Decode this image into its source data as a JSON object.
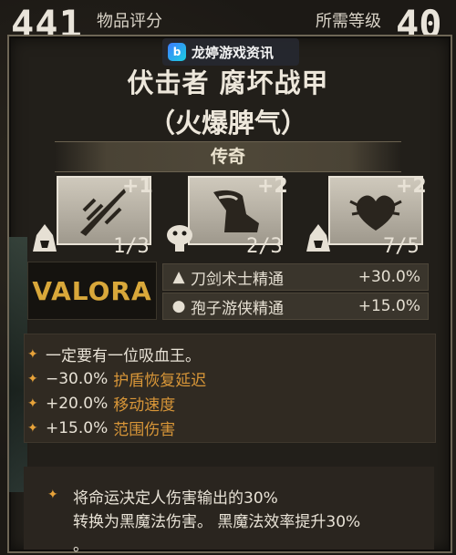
{
  "header": {
    "item_score": "441",
    "item_score_label": "物品评分",
    "required_level_label": "所需等级",
    "required_level": "40"
  },
  "watermark": {
    "logo": "b",
    "text": "龙婷游戏资讯"
  },
  "item": {
    "name_line1": "伏击者 腐坏战甲",
    "name_line2": "（火爆脾气）",
    "rarity": "传奇"
  },
  "talents": [
    {
      "icon": "sword-slash-icon",
      "bonus": "+1",
      "progress": "1/3",
      "class_icon": "hooded-rogue-icon"
    },
    {
      "icon": "boot-icon",
      "bonus": "+2",
      "progress": "2/3",
      "class_icon": "mushroom-icon"
    },
    {
      "icon": "heart-wings-icon",
      "bonus": "+2",
      "progress": "7/5",
      "class_icon": "hooded-rogue-icon"
    }
  ],
  "brand": {
    "name": "VALORA",
    "color": "#d9a83a"
  },
  "masteries": [
    {
      "icon": "hooded-rogue-icon",
      "name": "刀剑术士精通",
      "value": "+30.0%"
    },
    {
      "icon": "mushroom-icon",
      "name": "孢子游侠精通",
      "value": "+15.0%"
    }
  ],
  "stats": [
    {
      "bullet": "✦",
      "pre": "一定要有一位吸血王。",
      "value": "",
      "post": ""
    },
    {
      "bullet": "✦",
      "pre": "",
      "value": "−30.0%",
      "post": "护盾恢复延迟"
    },
    {
      "bullet": "✦",
      "pre": "",
      "value": "+20.0%",
      "post": "移动速度"
    },
    {
      "bullet": "✦",
      "pre": "",
      "value": "+15.0%",
      "post": "范围伤害"
    }
  ],
  "description": {
    "bullet": "✦",
    "line1": "将命运决定人伤害输出的30%",
    "line2": "转换为黑魔法伤害。 黑魔法效率提升30%",
    "line3": "。"
  },
  "colors": {
    "accent": "#e8a33a",
    "frame": "#6e6656",
    "gold": "#d9a83a"
  }
}
